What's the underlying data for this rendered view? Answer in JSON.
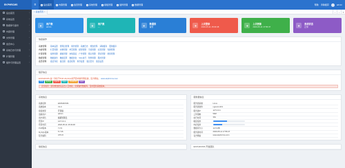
{
  "app": {
    "brand": "EKPHRCMS",
    "menu_icon": "hamburger-icon"
  },
  "topnav": [
    {
      "label": "后台首页",
      "active": true
    },
    {
      "label": "内容管理"
    },
    {
      "label": "会员管理"
    },
    {
      "label": "系统管理"
    },
    {
      "label": "模板管理"
    },
    {
      "label": "插件管理"
    },
    {
      "label": "数据管理"
    }
  ],
  "top_right": {
    "links": [
      "帮助",
      "清除缓存",
      "admin"
    ]
  },
  "sidebar": {
    "items": [
      "后台首页",
      "系统设置",
      "数据库与备份",
      "内容管理",
      "文件管理",
      "会员中心",
      "系统日志与管理",
      "扩展管理",
      "插件与管理设置"
    ]
  },
  "tabs": [
    {
      "label": "后台首页"
    }
  ],
  "cards": [
    {
      "title": "用户数",
      "sub": "admin",
      "color": "#2f8fe6",
      "icon": "user-icon"
    },
    {
      "title": "用户数",
      "sub": "—",
      "color": "#1fb5b6",
      "icon": "users-icon"
    },
    {
      "title": "数据库",
      "sub": "备份",
      "color": "#2a7fd6",
      "icon": "database-icon"
    },
    {
      "title": "上次登录",
      "sub": "2020-05-11 15:03:48",
      "color": "#ef5a4b",
      "icon": "clock-icon"
    },
    {
      "title": "上次更新",
      "sub": "2020-05-11 17:56:47",
      "color": "#3fb04a",
      "icon": "refresh-icon"
    },
    {
      "title": "系统状态",
      "sub": "正常",
      "color": "#8d5bc6",
      "icon": "server-icon"
    }
  ],
  "quick": {
    "title": "快捷操作",
    "rows": [
      {
        "label": "系统管理",
        "links": [
          "基本设置",
          "管理员管理",
          "角色管理",
          "系统日志",
          "修改密码",
          "清除缓存",
          "更新缓存"
        ]
      },
      {
        "label": "内容管理",
        "links": [
          "栏目管理",
          "文章管理",
          "单页管理",
          "模型管理",
          "字段管理",
          "标签管理",
          "专题管理"
        ]
      },
      {
        "label": "扩展管理",
        "links": [
          "插件管理",
          "模板管理",
          "友情链接",
          "广告管理",
          "留言管理",
          "评论管理",
          "搜索管理"
        ]
      },
      {
        "label": "数据管理",
        "links": [
          "数据备份",
          "数据还原",
          "数据优化",
          "SQL执行",
          "附件管理",
          "图片管理"
        ]
      },
      {
        "label": "会员管理",
        "links": [
          "会员列表",
          "会员组",
          "会员权限",
          "积分设置",
          "会员日志",
          "会员设置"
        ]
      }
    ]
  },
  "notice": {
    "title": "程序信息",
    "line": "EKPHRCMS 是一款基于PHP+MySQL的开源内容管理系统，官方网站：",
    "link": "www.ekphrcms.com",
    "badges": [
      {
        "label": "PHP",
        "color": "#2f8fe6"
      },
      {
        "label": "MySQL",
        "color": "#3fb04a"
      },
      {
        "label": "Apache",
        "color": "#ef5a4b"
      },
      {
        "label": "Nginx",
        "color": "#1fb5b6"
      },
      {
        "label": "ThinkPHP",
        "color": "#f0a53a"
      },
      {
        "label": "Layui",
        "color": "#8d5bc6"
      }
    ],
    "alert": "安全提示：建议修改默认后台入口地址，定期备份数据库，及时更新系统版本。"
  },
  "system_info": {
    "title": "系统信息",
    "rows": [
      {
        "k": "系统名称",
        "v": "EKPHRCMS"
      },
      {
        "k": "系统版本",
        "v": "V1.0"
      },
      {
        "k": "授权类型",
        "v": "开源版"
      },
      {
        "k": "当前用户",
        "v": "admin"
      },
      {
        "k": "用户角色",
        "v": "超级管理员"
      },
      {
        "k": "登录IP",
        "v": "127.0.0.1"
      },
      {
        "k": "登录时间",
        "v": "2020-05-11 15:03:48"
      },
      {
        "k": "PHP版本",
        "v": "7.2.9"
      },
      {
        "k": "MySQL版本",
        "v": "5.7.26"
      },
      {
        "k": "程序编码",
        "v": "UTF-8"
      }
    ]
  },
  "server_info": {
    "title": "服务器信息",
    "rows": [
      {
        "k": "服务器系统",
        "v": "Linux"
      },
      {
        "k": "服务器软件",
        "v": "nginx/1.18.0"
      },
      {
        "k": "服务器IP",
        "v": "127.0.0.1"
      },
      {
        "k": "上传限制",
        "v": "50M"
      },
      {
        "k": "执行时间",
        "v": "30s"
      },
      {
        "k": "磁盘使用",
        "progress": 0.45
      },
      {
        "k": "内存使用",
        "progress": 0.3
      },
      {
        "k": "数据库大小",
        "v": "12.6 MB"
      },
      {
        "k": "服务器时间",
        "v": "2020-05-11 17:56:47"
      },
      {
        "k": "官方网站",
        "v": "www.ekphrcms.com"
      }
    ]
  },
  "bottom": {
    "left_title": "版权信息",
    "right_title": "EKPHRCMS 开发团队"
  }
}
